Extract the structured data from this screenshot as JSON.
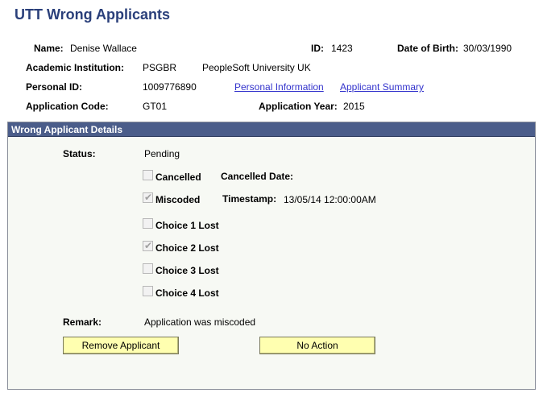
{
  "page": {
    "title": "UTT Wrong Applicants"
  },
  "header": {
    "name_label": "Name:",
    "name_value": "Denise Wallace",
    "id_label": "ID:",
    "id_value": "1423",
    "dob_label": "Date of Birth:",
    "dob_value": "30/03/1990",
    "institution_label": "Academic Institution:",
    "institution_code": "PSGBR",
    "institution_name": "PeopleSoft University UK",
    "personal_id_label": "Personal ID:",
    "personal_id_value": "1009776890",
    "link_personal_info": "Personal Information",
    "link_applicant_summary": "Applicant Summary",
    "app_code_label": "Application Code:",
    "app_code_value": "GT01",
    "app_year_label": "Application Year:",
    "app_year_value": "2015"
  },
  "details": {
    "section_title": "Wrong Applicant Details",
    "status_label": "Status:",
    "status_value": "Pending",
    "cancelled": {
      "label": "Cancelled",
      "checked": false
    },
    "cancelled_date_label": "Cancelled Date:",
    "miscoded": {
      "label": "Miscoded",
      "checked": true
    },
    "timestamp_label": "Timestamp:",
    "timestamp_value": "13/05/14 12:00:00AM",
    "choices": [
      {
        "label": "Choice 1 Lost",
        "checked": false
      },
      {
        "label": "Choice 2 Lost",
        "checked": true
      },
      {
        "label": "Choice 3 Lost",
        "checked": false
      },
      {
        "label": "Choice 4 Lost",
        "checked": false
      }
    ],
    "remark_label": "Remark:",
    "remark_value": "Application was miscoded"
  },
  "buttons": {
    "remove_applicant": "Remove Applicant",
    "no_action": "No Action"
  },
  "colors": {
    "title": "#2a3f7a",
    "section_header": "#4b5d8a",
    "link": "#3333cc",
    "button_bg": "#ffffb0"
  }
}
